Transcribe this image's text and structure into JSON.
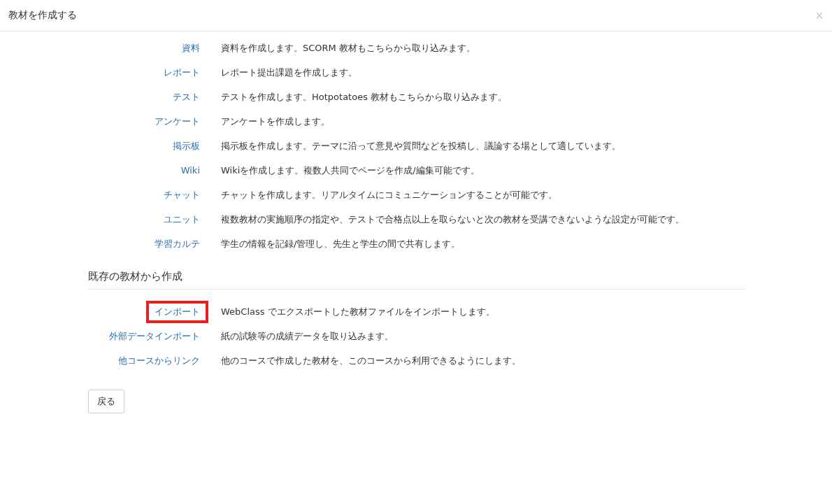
{
  "dialog": {
    "title": "教材を作成する",
    "close": "×"
  },
  "new_items": [
    {
      "label": "資料",
      "description": "資料を作成します。SCORM 教材もこちらから取り込みます。",
      "highlighted": false
    },
    {
      "label": "レポート",
      "description": "レポート提出課題を作成します。",
      "highlighted": false
    },
    {
      "label": "テスト",
      "description": "テストを作成します。Hotpotatoes 教材もこちらから取り込みます。",
      "highlighted": false
    },
    {
      "label": "アンケート",
      "description": "アンケートを作成します。",
      "highlighted": false
    },
    {
      "label": "掲示板",
      "description": "掲示板を作成します。テーマに沿って意見や質問などを投稿し、議論する場として適しています。",
      "highlighted": false
    },
    {
      "label": "Wiki",
      "description": "Wikiを作成します。複数人共同でページを作成/編集可能です。",
      "highlighted": false
    },
    {
      "label": "チャット",
      "description": "チャットを作成します。リアルタイムにコミュニケーションすることが可能です。",
      "highlighted": false
    },
    {
      "label": "ユニット",
      "description": "複数教材の実施順序の指定や、テストで合格点以上を取らないと次の教材を受講できないような設定が可能です。",
      "highlighted": false
    },
    {
      "label": "学習カルテ",
      "description": "学生の情報を記録/管理し、先生と学生の間で共有します。",
      "highlighted": false
    }
  ],
  "existing_section": {
    "heading": "既存の教材から作成",
    "items": [
      {
        "label": "インポート",
        "description": "WebClass でエクスポートした教材ファイルをインポートします。",
        "highlighted": true
      },
      {
        "label": "外部データインポート",
        "description": "紙の試験等の成績データを取り込みます。",
        "highlighted": false
      },
      {
        "label": "他コースからリンク",
        "description": "他のコースで作成した教材を、このコースから利用できるようにします。",
        "highlighted": false
      }
    ]
  },
  "back_button": "戻る"
}
